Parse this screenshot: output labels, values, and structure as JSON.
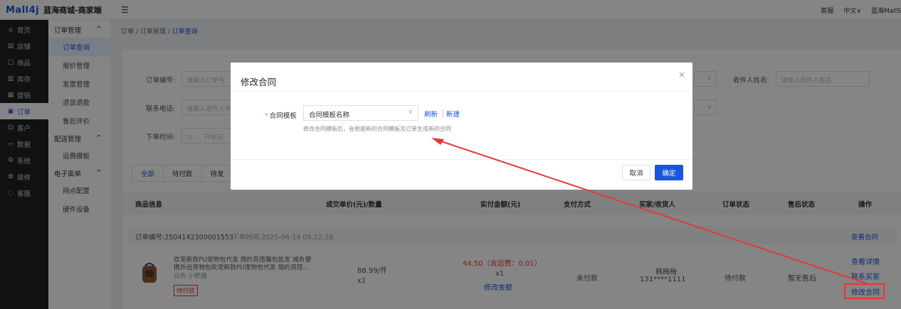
{
  "app": {
    "logo": "Mall4j",
    "title": "蓝海商城-商家端"
  },
  "topbar": {
    "service": "客服",
    "language": "中文∨",
    "user": "蓝海MallS"
  },
  "sidebar_main": [
    {
      "icon": "home-icon",
      "glyph": "⌂",
      "label": "首页"
    },
    {
      "icon": "store-icon",
      "glyph": "▤",
      "label": "店铺"
    },
    {
      "icon": "product-icon",
      "glyph": "▢",
      "label": "商品"
    },
    {
      "icon": "inventory-icon",
      "glyph": "▥",
      "label": "库存"
    },
    {
      "icon": "marketing-icon",
      "glyph": "▦",
      "label": "营销"
    },
    {
      "icon": "order-icon",
      "glyph": "▣",
      "label": "订单",
      "active": true
    },
    {
      "icon": "customer-icon",
      "glyph": "☺",
      "label": "客户"
    },
    {
      "icon": "data-icon",
      "glyph": "▭",
      "label": "数据"
    },
    {
      "icon": "system-icon",
      "glyph": "⚙",
      "label": "系统"
    },
    {
      "icon": "decoration-icon",
      "glyph": "✿",
      "label": "装修"
    },
    {
      "icon": "service-icon",
      "glyph": "◌",
      "label": "客服"
    }
  ],
  "sidebar_sub": {
    "group1": "订单管理",
    "group1_items": [
      "订单查询",
      "报价管理",
      "发票管理",
      "退货退款",
      "售后评价"
    ],
    "group2": "配送管理",
    "group2_items": [
      "运费模板"
    ],
    "group3": "电子面单",
    "group3_items": [
      "网点配置",
      "硬件设备"
    ],
    "chevron": "^"
  },
  "breadcrumb": {
    "a": "订单",
    "b": "订单管理",
    "c": "订单查询",
    "sep": "/"
  },
  "filters": {
    "order_no_label": "订单编号:",
    "order_no_placeholder": "请输入订单号",
    "phone_label": "联系电话:",
    "phone_placeholder": "请输入收件人手",
    "time_label": "下单时间:",
    "time_start": "开始日",
    "receiver_label": "收件人姓名:",
    "receiver_placeholder": "请输入收件人姓名"
  },
  "tabs": [
    "全部",
    "待付款",
    "待发"
  ],
  "table_headers": [
    "商品信息",
    "成交单价(元)/数量",
    "实付金额(元)",
    "支付方式",
    "买家/收货人",
    "订单状态",
    "售后状态",
    "操作"
  ],
  "order": {
    "no_label": "订单编号:2504142300001553",
    "time_label": "下单时间:2025-04-14 09:22:28",
    "view_contract": "查看合同",
    "product_name_1": "欢宠新款PU宠物包代发 简约百搭猫包批发 减负便",
    "product_name_2": "携外出宠物包欢宠新款PU宠物包代发 简约百搭...",
    "spec": "白色 小肥猫",
    "status_tag": "待付款",
    "unit_price": "88.99/件",
    "qty": "x1",
    "paid": "44.50（含运费：0.01）",
    "paid_qty": "x1",
    "modify_amount": "修改金额",
    "pay_method": "未付款",
    "buyer_name": "韩梅梅",
    "buyer_phone": "131****1111",
    "order_status": "待付款",
    "after_sale": "暂无售后",
    "op_detail": "查看详情",
    "op_contact": "联系买家",
    "op_modify": "修改合同"
  },
  "modal": {
    "title": "修改合同",
    "close": "×",
    "required_mark": "*",
    "field_label": "合同模板",
    "select_value": "合同模板名称",
    "refresh": "刷新",
    "create": "新建",
    "hint": "修改合同模板后，会根据新的合同模板及订单生成新的合同",
    "cancel": "取消",
    "confirm": "确定"
  },
  "colors": {
    "primary": "#1a56db",
    "danger": "#e53935",
    "sidebar": "#1f2126"
  }
}
